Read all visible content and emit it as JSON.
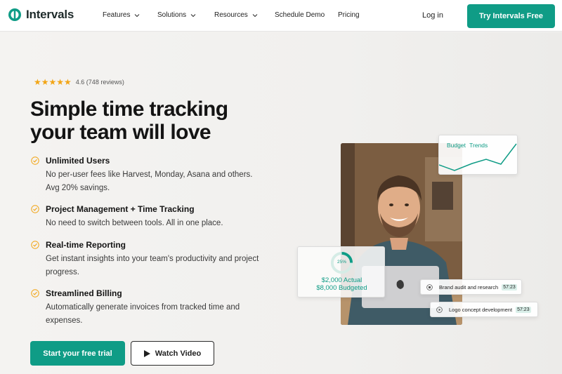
{
  "nav": {
    "brand": "Intervals",
    "items": [
      {
        "label": "Features",
        "has_dropdown": true
      },
      {
        "label": "Solutions",
        "has_dropdown": true
      },
      {
        "label": "Resources",
        "has_dropdown": true
      },
      {
        "label": "Schedule Demo",
        "has_dropdown": false
      },
      {
        "label": "Pricing",
        "has_dropdown": false
      }
    ],
    "login": "Log in",
    "cta": "Try Intervals Free"
  },
  "hero": {
    "stars": "★★★★★",
    "rating": "4.6 (748 reviews)",
    "headline_line1": "Simple time tracking",
    "headline_line2": "your team will love",
    "features": [
      {
        "title": "Unlimited Users",
        "desc": "No per-user fees like Harvest, Monday, Asana and others. Avg 20% savings."
      },
      {
        "title": "Project Management + Time Tracking",
        "desc": "No need to switch between tools. All in one place."
      },
      {
        "title": "Real-time Reporting",
        "desc": "Get instant insights into your team's productivity and project progress."
      },
      {
        "title": "Streamlined Billing",
        "desc": "Automatically generate invoices from tracked time and expenses."
      }
    ],
    "primary_cta": "Start your free trial",
    "secondary_cta": "Watch Video"
  },
  "visual": {
    "budget_card": {
      "label": "Budget Trends"
    },
    "donut_card": {
      "percent": "25%",
      "percent_value": 0.25,
      "actual": "$2,000 Actual",
      "budgeted": "$8,000 Budgeted"
    },
    "tasks": [
      {
        "name": "Brand audit and research",
        "time": "57:23",
        "icon": "stop-icon"
      },
      {
        "name": "Logo concept development",
        "time": "57:23",
        "icon": "play-icon"
      }
    ]
  },
  "colors": {
    "accent": "#0f9c86",
    "star": "#f2a516",
    "text": "#141414"
  }
}
